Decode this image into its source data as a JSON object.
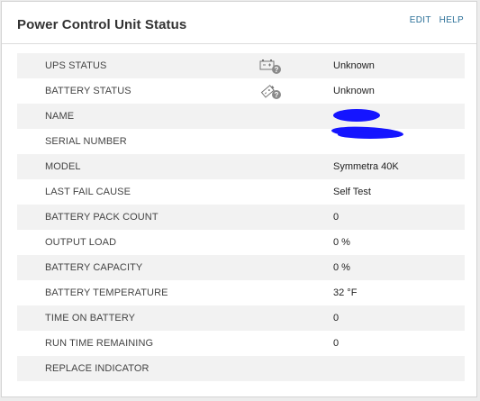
{
  "panel": {
    "title": "Power Control Unit Status",
    "edit_label": "EDIT",
    "help_label": "HELP"
  },
  "rows": [
    {
      "label": "UPS STATUS",
      "value": "Unknown",
      "icon": "ups-unknown-icon"
    },
    {
      "label": "BATTERY STATUS",
      "value": "Unknown",
      "icon": "battery-unknown-icon"
    },
    {
      "label": "NAME",
      "value": "",
      "redacted": true
    },
    {
      "label": "SERIAL NUMBER",
      "value": "",
      "redacted": true
    },
    {
      "label": "MODEL",
      "value": "Symmetra 40K"
    },
    {
      "label": "LAST FAIL CAUSE",
      "value": "Self Test"
    },
    {
      "label": "BATTERY PACK COUNT",
      "value": "0"
    },
    {
      "label": "OUTPUT LOAD",
      "value": "0 %"
    },
    {
      "label": "BATTERY CAPACITY",
      "value": "0 %"
    },
    {
      "label": "BATTERY TEMPERATURE",
      "value": "32 °F"
    },
    {
      "label": "TIME ON BATTERY",
      "value": "0"
    },
    {
      "label": "RUN TIME REMAINING",
      "value": "0"
    },
    {
      "label": "REPLACE INDICATOR",
      "value": ""
    }
  ],
  "colors": {
    "link": "#2a6f97",
    "redaction": "#1515ff",
    "row_stripe": "#f2f2f2"
  }
}
